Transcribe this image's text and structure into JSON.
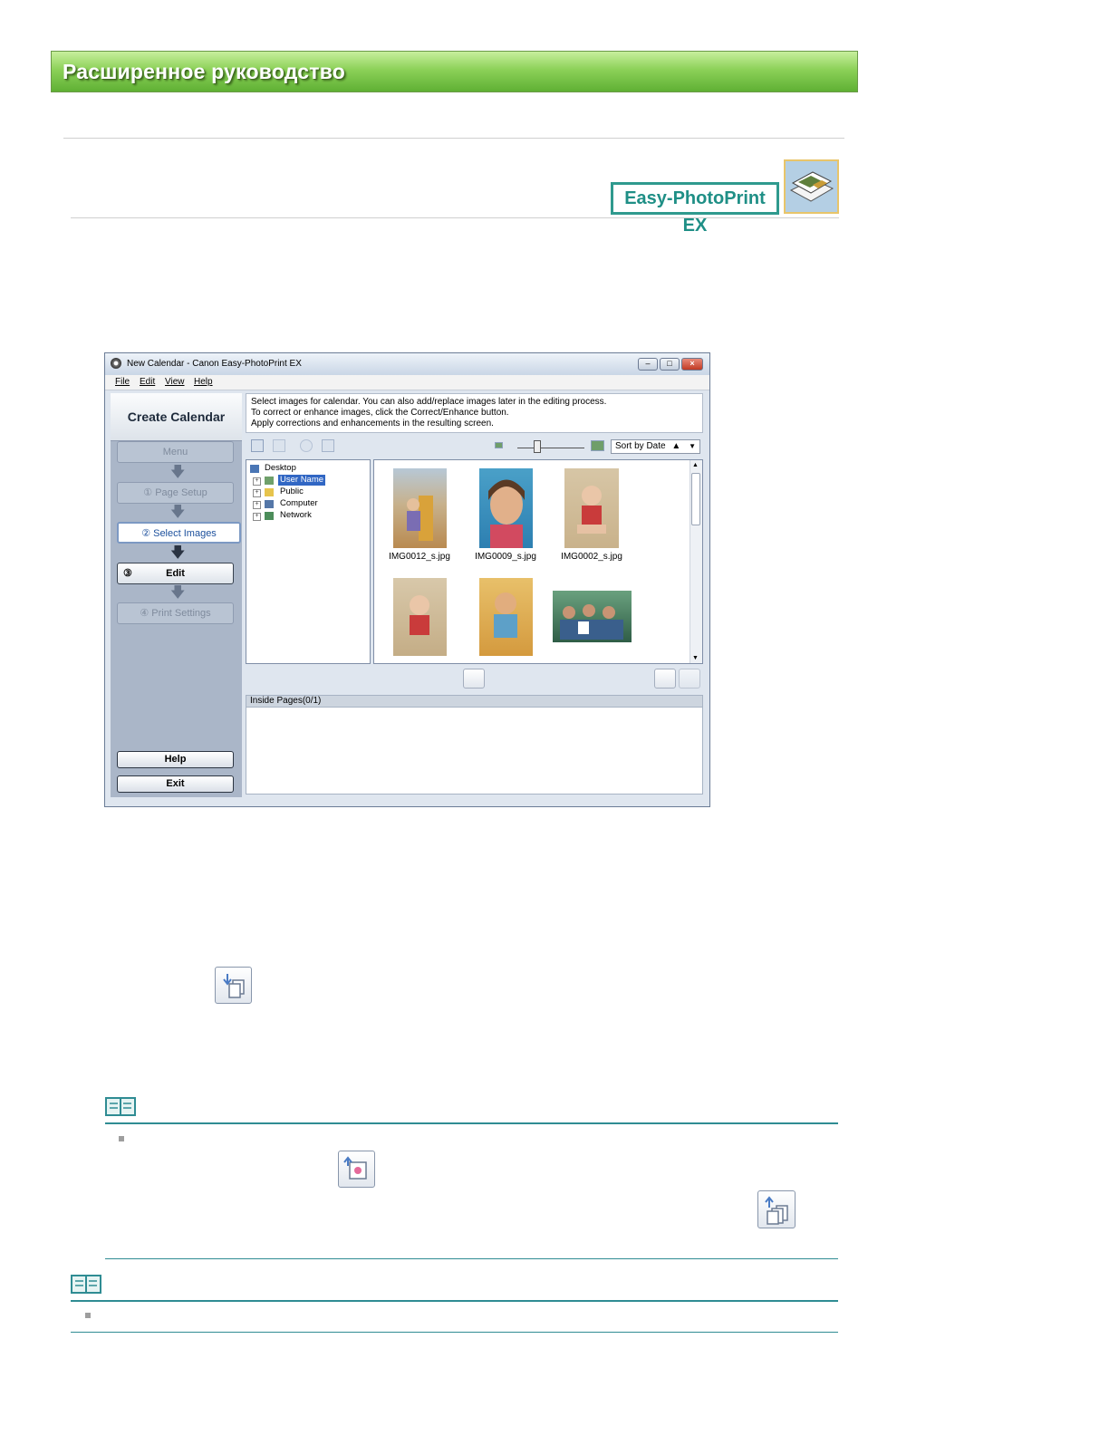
{
  "header": {
    "title": "Расширенное руководство"
  },
  "product": {
    "name": "Easy-PhotoPrint EX"
  },
  "app": {
    "title": "New Calendar - Canon Easy-PhotoPrint EX",
    "window_buttons": {
      "minimize": "–",
      "maximize": "□",
      "close": "×"
    },
    "menu": [
      "File",
      "Edit",
      "View",
      "Help"
    ],
    "left_panel": {
      "title": "Create Calendar",
      "steps": [
        {
          "label": "Menu"
        },
        {
          "label": "①   Page Setup"
        },
        {
          "label": "②   Select Images"
        },
        {
          "label": "Edit",
          "number": "③"
        },
        {
          "label": "④   Print Settings"
        }
      ],
      "help": "Help",
      "exit": "Exit"
    },
    "instructions": [
      "Select images for calendar. You can also add/replace images later in the editing process.",
      "To correct or enhance images, click the Correct/Enhance button.",
      "Apply corrections and enhancements in the resulting screen."
    ],
    "sort": {
      "value": "Sort by Date",
      "indicator": "▲"
    },
    "tree": {
      "root": "Desktop",
      "children": [
        "User Name",
        "Public",
        "Computer",
        "Network"
      ]
    },
    "thumbnails": [
      {
        "caption": "IMG0012_s.jpg"
      },
      {
        "caption": "IMG0009_s.jpg"
      },
      {
        "caption": "IMG0002_s.jpg"
      }
    ],
    "inside_pages": "Inside Pages(0/1)"
  },
  "colors": {
    "banner_green": "#7cc44a",
    "teal": "#2f8c93",
    "window_bg": "#dfe6ef"
  }
}
